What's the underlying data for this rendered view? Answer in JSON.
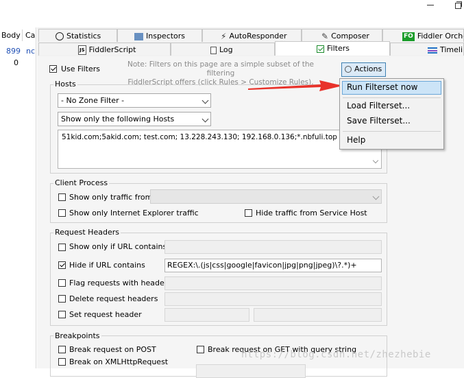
{
  "left_list": {
    "headers": [
      "Body",
      "Ca"
    ],
    "rows": [
      {
        "body": "899",
        "ca": "nc"
      },
      {
        "body": "0",
        "ca": ""
      }
    ]
  },
  "tabs_row1": [
    {
      "label": "Statistics",
      "icon": "stopwatch-icon"
    },
    {
      "label": "Inspectors",
      "icon": "inspectors-icon"
    },
    {
      "label": "AutoResponder",
      "icon": "lightning-icon"
    },
    {
      "label": "Composer",
      "icon": "composer-icon"
    },
    {
      "label": "Fiddler Orches",
      "icon": "fo-icon",
      "icon_text": "FO"
    }
  ],
  "tabs_row2": [
    {
      "label": "FiddlerScript",
      "icon": "js-file-icon",
      "icon_text": "JS"
    },
    {
      "label": "Log",
      "icon": "log-icon"
    },
    {
      "label": "Filters",
      "icon": "checkbox-icon",
      "selected": true
    },
    {
      "label": "Timelin",
      "icon": "timeline-icon"
    }
  ],
  "filters": {
    "use_filters_label": "Use Filters",
    "use_filters_checked": true,
    "note": "Note: Filters on this page are a simple subset of the filtering FiddlerScript offers (click Rules > Customize Rules).",
    "note_line1": "Note: Filters on this page are a simple subset of the filtering",
    "note_line2": "FiddlerScript offers (click Rules > Customize Rules).",
    "actions_label": "Actions",
    "hosts": {
      "title": "Hosts",
      "zone_filter": "- No Zone Filter -",
      "host_filter": "Show only the following Hosts",
      "hosts_text": "51kid.com;5akid.com; test.com; 13.228.243.130; 192.168.0.136;*.nbfuli.top"
    },
    "client_process": {
      "title": "Client Process",
      "show_only_traffic_from": "Show only traffic from",
      "show_only_ie": "Show only Internet Explorer traffic",
      "hide_service_host": "Hide traffic from Service Host"
    },
    "request_headers": {
      "title": "Request Headers",
      "show_if_url": "Show only if URL contains",
      "hide_if_url": "Hide if URL contains",
      "hide_if_url_checked": true,
      "hide_if_url_value": "REGEX:\\.(js|css|google|favicon|jpg|png|jpeg)\\?.*)+",
      "flag_requests": "Flag requests with headers",
      "delete_headers": "Delete request headers",
      "set_header": "Set request header"
    },
    "breakpoints": {
      "title": "Breakpoints",
      "break_post": "Break request on POST",
      "break_get": "Break request on GET with query string",
      "break_xhr": "Break on XMLHttpRequest"
    }
  },
  "actions_menu": {
    "items": [
      "Run Filterset now",
      "Load Filterset...",
      "Save Filterset...",
      "Help"
    ],
    "highlighted": "Run Filterset now"
  },
  "colors": {
    "arrow": "#e8322a",
    "menu_highlight": "#cce4f7",
    "link_blue": "#1f4fb4"
  },
  "watermark": "https://blog.csdn.net/zhezhebie"
}
